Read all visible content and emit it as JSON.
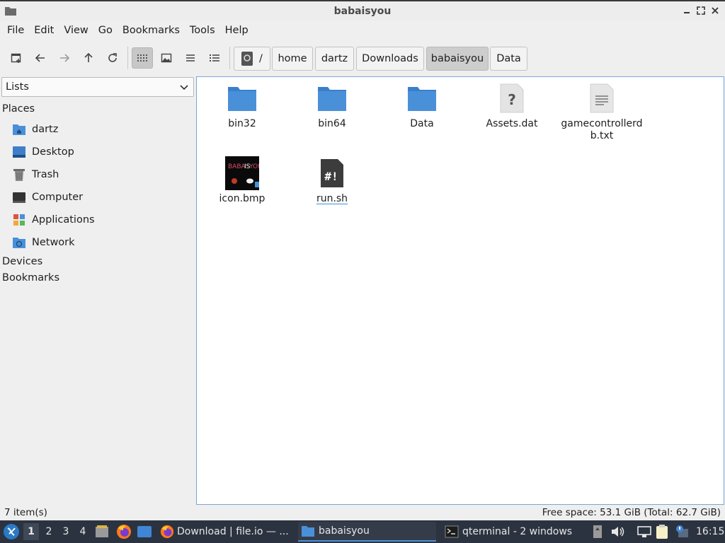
{
  "window": {
    "title": "babaisyou"
  },
  "menu": [
    "File",
    "Edit",
    "View",
    "Go",
    "Bookmarks",
    "Tools",
    "Help"
  ],
  "breadcrumb": {
    "root": "/",
    "segments": [
      "home",
      "dartz",
      "Downloads",
      "babaisyou",
      "Data"
    ],
    "current": "babaisyou"
  },
  "sidepane": {
    "mode": "Lists",
    "places_header": "Places",
    "places": [
      {
        "label": "dartz",
        "icon": "home-folder-icon"
      },
      {
        "label": "Desktop",
        "icon": "desktop-icon"
      },
      {
        "label": "Trash",
        "icon": "trash-icon"
      },
      {
        "label": "Computer",
        "icon": "computer-icon"
      },
      {
        "label": "Applications",
        "icon": "applications-icon"
      },
      {
        "label": "Network",
        "icon": "network-icon"
      }
    ],
    "devices_header": "Devices",
    "bookmarks_header": "Bookmarks"
  },
  "files": [
    {
      "name": "bin32",
      "type": "folder"
    },
    {
      "name": "bin64",
      "type": "folder"
    },
    {
      "name": "Data",
      "type": "folder"
    },
    {
      "name": "Assets.dat",
      "type": "unknown"
    },
    {
      "name": "gamecontrollerdb.txt",
      "type": "text"
    },
    {
      "name": "icon.bmp",
      "type": "image",
      "thumb_text": [
        "BABA",
        "IS",
        "YOU"
      ]
    },
    {
      "name": "run.sh",
      "type": "script"
    }
  ],
  "status": {
    "items": "7 item(s)",
    "free_space": "Free space: 53.1 GiB (Total: 62.7 GiB)"
  },
  "taskbar": {
    "workspaces": [
      "1",
      "2",
      "3",
      "4"
    ],
    "active_workspace": "1",
    "tasks": [
      {
        "label": "Download | file.io — ...",
        "icon": "firefox-icon"
      },
      {
        "label": "babaisyou",
        "icon": "folder-icon"
      },
      {
        "label": "qterminal - 2 windows",
        "icon": "terminal-icon"
      }
    ],
    "clock": "16:15"
  },
  "colors": {
    "folder": "#4a90d9",
    "selection_border": "#7aa8d6",
    "taskbar_bg": "#2c3340"
  }
}
